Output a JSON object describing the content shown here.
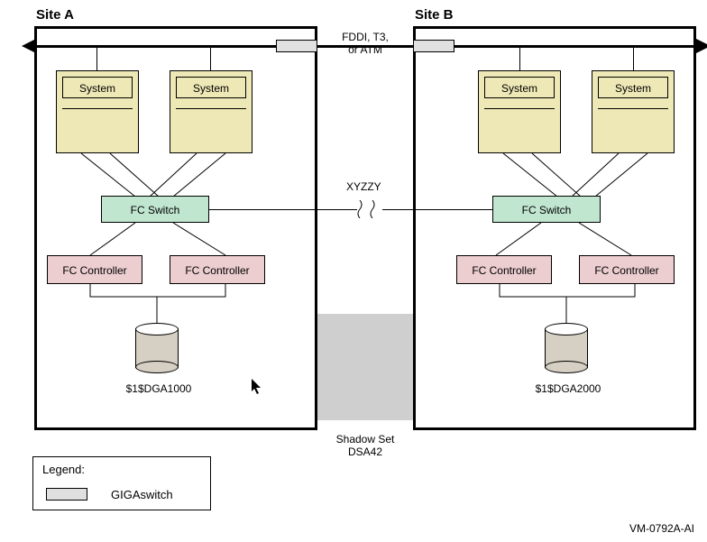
{
  "siteA": {
    "label": "Site A"
  },
  "siteB": {
    "label": "Site B"
  },
  "network": {
    "label_line1": "FDDI, T3,",
    "label_line2": "or ATM"
  },
  "interlink": {
    "label": "XYZZY"
  },
  "systems": {
    "label": "System"
  },
  "fcswitch": {
    "label": "FC Switch"
  },
  "fcctrl": {
    "label": "FC Controller"
  },
  "disks": {
    "a": "$1$DGA1000",
    "b": "$1$DGA2000"
  },
  "shadow": {
    "line1": "Shadow Set",
    "line2": "DSA42"
  },
  "legend": {
    "title": "Legend:",
    "item": "GIGAswitch"
  },
  "figure": {
    "id": "VM-0792A-AI"
  }
}
